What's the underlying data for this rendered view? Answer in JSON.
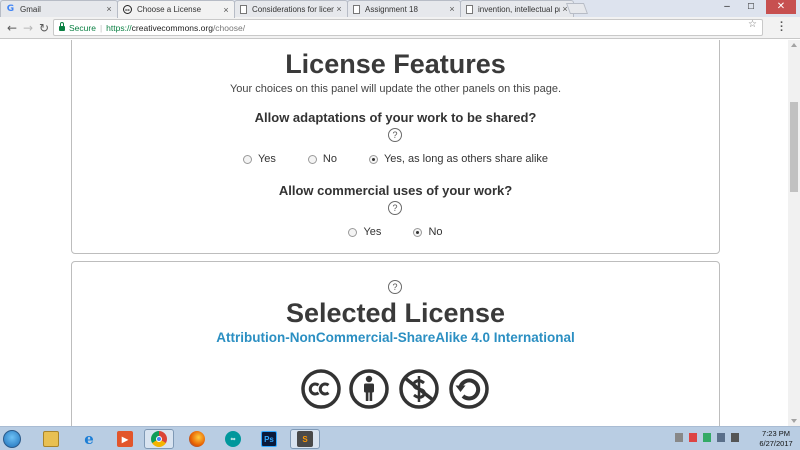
{
  "browser": {
    "tabs": [
      {
        "label": "Gmail",
        "icon": "gmail-icon",
        "active": false
      },
      {
        "label": "Choose a License",
        "icon": "creative-commons-icon",
        "active": true
      },
      {
        "label": "Considerations for licens",
        "icon": "document-icon",
        "active": false
      },
      {
        "label": "Assignment 18",
        "icon": "document-icon",
        "active": false
      },
      {
        "label": "invention, intellectual pro",
        "icon": "document-icon",
        "active": false
      }
    ],
    "window_controls": {
      "minimize": "–",
      "maximize": "☐",
      "close": "✕"
    },
    "toolbar": {
      "back": "←",
      "forward": "→",
      "reload": "↻",
      "secure_label": "Secure",
      "url_scheme": "https://",
      "url_host": "creativecommons.org",
      "url_path": "/choose/"
    }
  },
  "license_features": {
    "title": "License Features",
    "subtitle": "Your choices on this panel will update the other panels on this page.",
    "q1": {
      "question": "Allow adaptations of your work to be shared?",
      "help": "?",
      "options": [
        {
          "label": "Yes",
          "selected": false
        },
        {
          "label": "No",
          "selected": false
        },
        {
          "label": "Yes, as long as others share alike",
          "selected": true
        }
      ]
    },
    "q2": {
      "question": "Allow commercial uses of your work?",
      "help": "?",
      "options": [
        {
          "label": "Yes",
          "selected": false
        },
        {
          "label": "No",
          "selected": true
        }
      ]
    }
  },
  "selected_license": {
    "help": "?",
    "title": "Selected License",
    "license_name": "Attribution-NonCommercial-ShareAlike 4.0 International",
    "badges": [
      "cc-icon",
      "attribution-icon",
      "noncommercial-icon",
      "sharealike-icon"
    ]
  },
  "taskbar": {
    "apps": [
      "explorer-icon",
      "ie-icon",
      "media-player-icon",
      "chrome-icon",
      "firefox-icon",
      "arduino-icon",
      "photoshop-icon",
      "sublime-icon"
    ],
    "app_letters": {
      "photoshop": "Ps",
      "sublime": "S"
    },
    "time": "7:23 PM",
    "date": "6/27/2017"
  },
  "colors": {
    "link": "#2b8fc2",
    "secure": "#0b8043",
    "taskbar": "#b9cde3"
  }
}
